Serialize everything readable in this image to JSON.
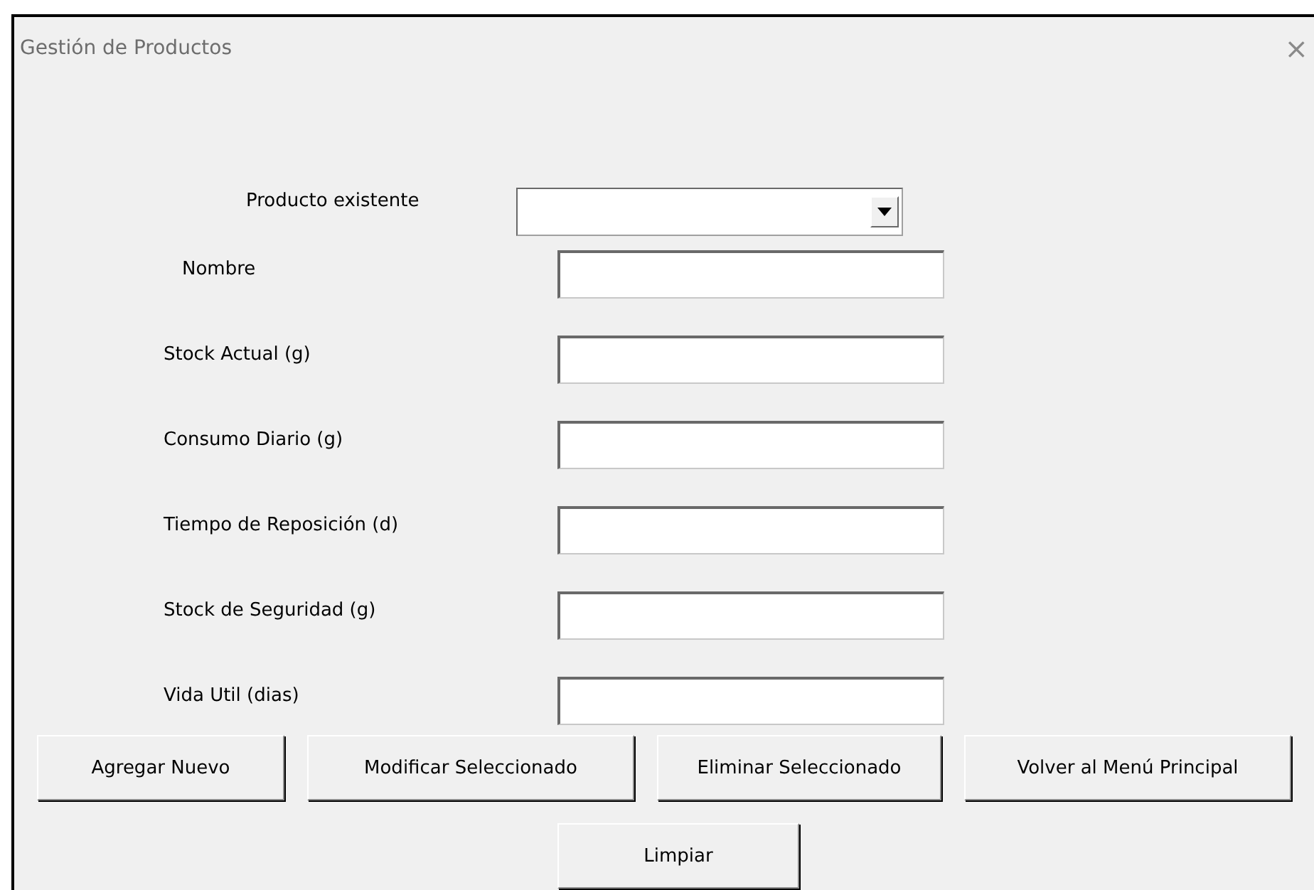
{
  "window": {
    "title": "Gestión de Productos",
    "close": "×"
  },
  "product_selector": {
    "label": "Producto existente"
  },
  "fields": [
    {
      "label": "Nombre"
    },
    {
      "label": "Stock Actual (g)"
    },
    {
      "label": "Consumo Diario (g)"
    },
    {
      "label": "Tiempo de Reposición (d)"
    },
    {
      "label": "Stock de Seguridad (g)"
    },
    {
      "label": "Vida Util (dias)"
    }
  ],
  "buttons": [
    "Agregar Nuevo",
    "Modificar Seleccionado",
    "Eliminar Seleccionado",
    "Volver al Menú Principal"
  ],
  "footer_buttons": [
    "Limpiar"
  ]
}
